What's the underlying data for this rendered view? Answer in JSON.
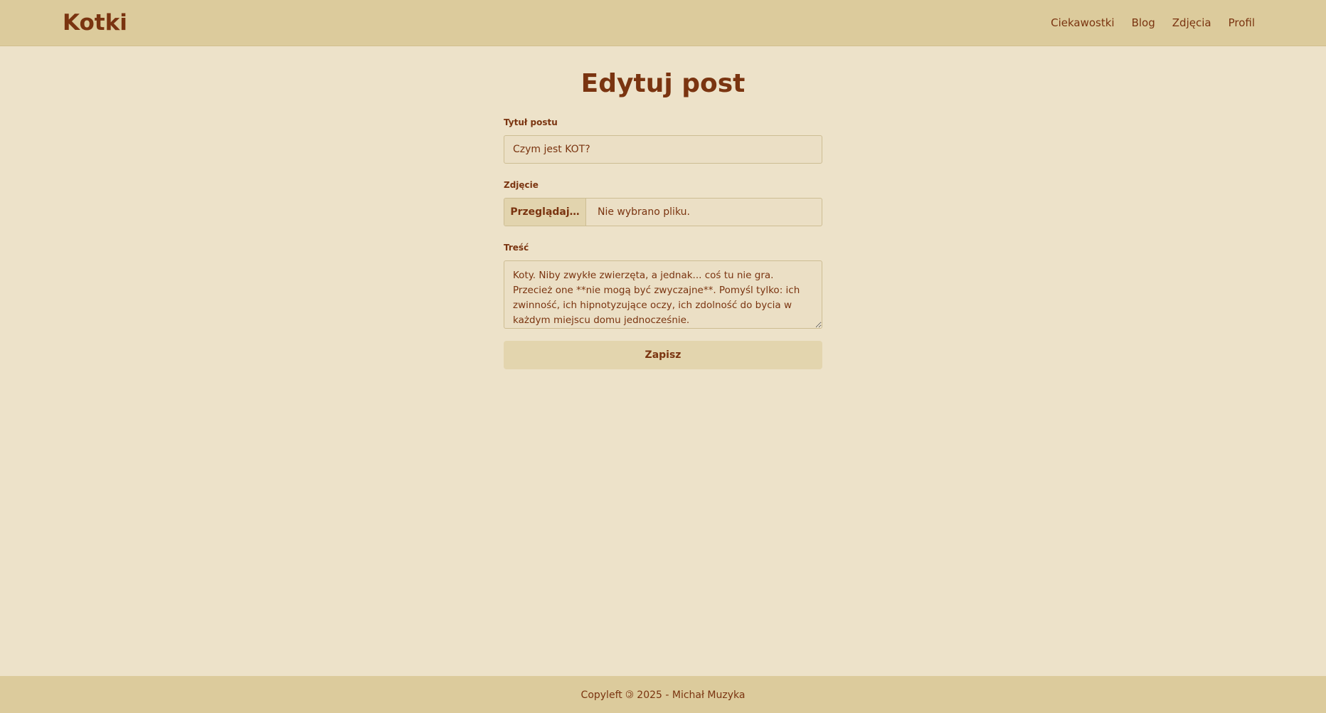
{
  "navbar": {
    "brand": "Kotki",
    "links": [
      "Ciekawostki",
      "Blog",
      "Zdjęcia",
      "Profil"
    ]
  },
  "page": {
    "title": "Edytuj post"
  },
  "form": {
    "title_label": "Tytuł postu",
    "title_value": "Czym jest KOT?",
    "photo_label": "Zdjęcie",
    "photo_button": "Przeglądaj…",
    "photo_status": "Nie wybrano pliku.",
    "content_label": "Treść",
    "content_value": "Koty. Niby zwykłe zwierzęta, a jednak... coś tu nie gra.\nPrzecież one **nie mogą być zwyczajne**. Pomyśl tylko: ich zwinność, ich hipnotyzujące oczy, ich zdolność do bycia w każdym miejscu domu jednocześnie.",
    "save_label": "Zapisz"
  },
  "footer": {
    "text": "Copyleft 🄯 2025 - Michał Muzyka"
  },
  "colors": {
    "background": "#ede2c9",
    "navbar": "#dccb9c",
    "text": "#7a3410"
  }
}
